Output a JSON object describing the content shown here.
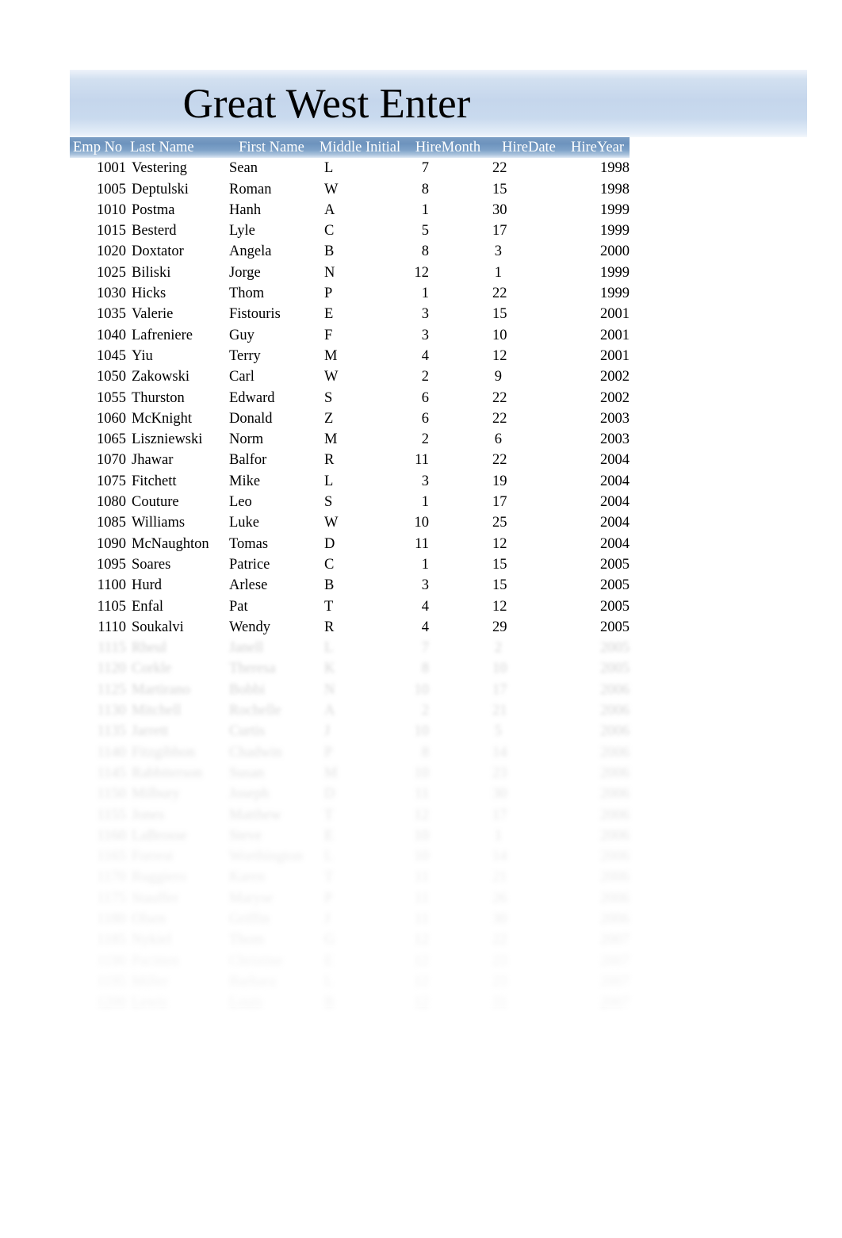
{
  "document": {
    "title": "Great West Enter",
    "accent_banner_color": "#c5d6ec",
    "header_row_color": "#6d93bd",
    "header_text_color": "#ffffff",
    "body_text_color": "#000000"
  },
  "table": {
    "columns": [
      {
        "key": "emp_no",
        "label": "Emp  No"
      },
      {
        "key": "last_name",
        "label": "Last Name"
      },
      {
        "key": "first_name",
        "label": "First Name"
      },
      {
        "key": "middle_initial",
        "label": "Middle Initial"
      },
      {
        "key": "hire_month",
        "label": "HireMonth"
      },
      {
        "key": "hire_date",
        "label": "HireDate"
      },
      {
        "key": "hire_year",
        "label": "HireYear"
      }
    ],
    "rows": [
      {
        "emp_no": "1001",
        "last_name": "Vestering",
        "first_name": "Sean",
        "middle_initial": "L",
        "hire_month": "7",
        "hire_date": "22",
        "hire_year": "1998",
        "legible": true
      },
      {
        "emp_no": "1005",
        "last_name": "Deptulski",
        "first_name": "Roman",
        "middle_initial": "W",
        "hire_month": "8",
        "hire_date": "15",
        "hire_year": "1998",
        "legible": true
      },
      {
        "emp_no": "1010",
        "last_name": "Postma",
        "first_name": "Hanh",
        "middle_initial": "A",
        "hire_month": "1",
        "hire_date": "30",
        "hire_year": "1999",
        "legible": true
      },
      {
        "emp_no": "1015",
        "last_name": "Besterd",
        "first_name": "Lyle",
        "middle_initial": "C",
        "hire_month": "5",
        "hire_date": "17",
        "hire_year": "1999",
        "legible": true
      },
      {
        "emp_no": "1020",
        "last_name": "Doxtator",
        "first_name": "Angela",
        "middle_initial": "B",
        "hire_month": "8",
        "hire_date": "3",
        "hire_year": "2000",
        "legible": true
      },
      {
        "emp_no": "1025",
        "last_name": "Biliski",
        "first_name": "Jorge",
        "middle_initial": "N",
        "hire_month": "12",
        "hire_date": "1",
        "hire_year": "1999",
        "legible": true
      },
      {
        "emp_no": "1030",
        "last_name": "Hicks",
        "first_name": "Thom",
        "middle_initial": "P",
        "hire_month": "1",
        "hire_date": "22",
        "hire_year": "1999",
        "legible": true
      },
      {
        "emp_no": "1035",
        "last_name": "Valerie",
        "first_name": "Fistouris",
        "middle_initial": "E",
        "hire_month": "3",
        "hire_date": "15",
        "hire_year": "2001",
        "legible": true
      },
      {
        "emp_no": "1040",
        "last_name": "Lafreniere",
        "first_name": "Guy",
        "middle_initial": "F",
        "hire_month": "3",
        "hire_date": "10",
        "hire_year": "2001",
        "legible": true
      },
      {
        "emp_no": "1045",
        "last_name": "Yiu",
        "first_name": "Terry",
        "middle_initial": "M",
        "hire_month": "4",
        "hire_date": "12",
        "hire_year": "2001",
        "legible": true
      },
      {
        "emp_no": "1050",
        "last_name": "Zakowski",
        "first_name": "Carl",
        "middle_initial": "W",
        "hire_month": "2",
        "hire_date": "9",
        "hire_year": "2002",
        "legible": true
      },
      {
        "emp_no": "1055",
        "last_name": "Thurston",
        "first_name": "Edward",
        "middle_initial": "S",
        "hire_month": "6",
        "hire_date": "22",
        "hire_year": "2002",
        "legible": true
      },
      {
        "emp_no": "1060",
        "last_name": "McKnight",
        "first_name": "Donald",
        "middle_initial": "Z",
        "hire_month": "6",
        "hire_date": "22",
        "hire_year": "2003",
        "legible": true
      },
      {
        "emp_no": "1065",
        "last_name": "Liszniewski",
        "first_name": "Norm",
        "middle_initial": "M",
        "hire_month": "2",
        "hire_date": "6",
        "hire_year": "2003",
        "legible": true
      },
      {
        "emp_no": "1070",
        "last_name": "Jhawar",
        "first_name": "Balfor",
        "middle_initial": "R",
        "hire_month": "11",
        "hire_date": "22",
        "hire_year": "2004",
        "legible": true
      },
      {
        "emp_no": "1075",
        "last_name": "Fitchett",
        "first_name": "Mike",
        "middle_initial": "L",
        "hire_month": "3",
        "hire_date": "19",
        "hire_year": "2004",
        "legible": true
      },
      {
        "emp_no": "1080",
        "last_name": "Couture",
        "first_name": "Leo",
        "middle_initial": "S",
        "hire_month": "1",
        "hire_date": "17",
        "hire_year": "2004",
        "legible": true
      },
      {
        "emp_no": "1085",
        "last_name": "Williams",
        "first_name": "Luke",
        "middle_initial": "W",
        "hire_month": "10",
        "hire_date": "25",
        "hire_year": "2004",
        "legible": true
      },
      {
        "emp_no": "1090",
        "last_name": "McNaughton",
        "first_name": "Tomas",
        "middle_initial": "D",
        "hire_month": "11",
        "hire_date": "12",
        "hire_year": "2004",
        "legible": true
      },
      {
        "emp_no": "1095",
        "last_name": "Soares",
        "first_name": "Patrice",
        "middle_initial": "C",
        "hire_month": "1",
        "hire_date": "15",
        "hire_year": "2005",
        "legible": true
      },
      {
        "emp_no": "1100",
        "last_name": "Hurd",
        "first_name": "Arlese",
        "middle_initial": "B",
        "hire_month": "3",
        "hire_date": "15",
        "hire_year": "2005",
        "legible": true
      },
      {
        "emp_no": "1105",
        "last_name": "Enfal",
        "first_name": "Pat",
        "middle_initial": "T",
        "hire_month": "4",
        "hire_date": "12",
        "hire_year": "2005",
        "legible": true
      },
      {
        "emp_no": "1110",
        "last_name": "Soukalvi",
        "first_name": "Wendy",
        "middle_initial": "R",
        "hire_month": "4",
        "hire_date": "29",
        "hire_year": "2005",
        "legible": true
      },
      {
        "emp_no": "1115",
        "last_name": "Rheul",
        "first_name": "Janell",
        "middle_initial": "L",
        "hire_month": "7",
        "hire_date": "2",
        "hire_year": "2005",
        "legible": false
      },
      {
        "emp_no": "1120",
        "last_name": "Corkle",
        "first_name": "Theresa",
        "middle_initial": "K",
        "hire_month": "8",
        "hire_date": "10",
        "hire_year": "2005",
        "legible": false
      },
      {
        "emp_no": "1125",
        "last_name": "Martirano",
        "first_name": "Bobbi",
        "middle_initial": "N",
        "hire_month": "10",
        "hire_date": "17",
        "hire_year": "2006",
        "legible": false
      },
      {
        "emp_no": "1130",
        "last_name": "Mitchell",
        "first_name": "Rochelle",
        "middle_initial": "A",
        "hire_month": "2",
        "hire_date": "21",
        "hire_year": "2006",
        "legible": false
      },
      {
        "emp_no": "1135",
        "last_name": "Jarrett",
        "first_name": "Curtis",
        "middle_initial": "J",
        "hire_month": "10",
        "hire_date": "5",
        "hire_year": "2006",
        "legible": false
      },
      {
        "emp_no": "1140",
        "last_name": "Fitzgibbon",
        "first_name": "Chadwin",
        "middle_initial": "P",
        "hire_month": "8",
        "hire_date": "14",
        "hire_year": "2006",
        "legible": false
      },
      {
        "emp_no": "1145",
        "last_name": "Rabbiterson",
        "first_name": "Susan",
        "middle_initial": "M",
        "hire_month": "10",
        "hire_date": "23",
        "hire_year": "2006",
        "legible": false
      },
      {
        "emp_no": "1150",
        "last_name": "Milbury",
        "first_name": "Joseph",
        "middle_initial": "D",
        "hire_month": "11",
        "hire_date": "30",
        "hire_year": "2006",
        "legible": false
      },
      {
        "emp_no": "1155",
        "last_name": "Jones",
        "first_name": "Matthew",
        "middle_initial": "T",
        "hire_month": "12",
        "hire_date": "17",
        "hire_year": "2006",
        "legible": false
      },
      {
        "emp_no": "1160",
        "last_name": "LaBrosse",
        "first_name": "Steve",
        "middle_initial": "E",
        "hire_month": "10",
        "hire_date": "1",
        "hire_year": "2006",
        "legible": false
      },
      {
        "emp_no": "1165",
        "last_name": "Forrest",
        "first_name": "Worthington",
        "middle_initial": "L",
        "hire_month": "10",
        "hire_date": "14",
        "hire_year": "2006",
        "legible": false
      },
      {
        "emp_no": "1170",
        "last_name": "Ruggiero",
        "first_name": "Karen",
        "middle_initial": "T",
        "hire_month": "11",
        "hire_date": "21",
        "hire_year": "2006",
        "legible": false
      },
      {
        "emp_no": "1175",
        "last_name": "Stauffer",
        "first_name": "Maryse",
        "middle_initial": "P",
        "hire_month": "11",
        "hire_date": "26",
        "hire_year": "2006",
        "legible": false
      },
      {
        "emp_no": "1180",
        "last_name": "Olsen",
        "first_name": "Griffin",
        "middle_initial": "J",
        "hire_month": "11",
        "hire_date": "30",
        "hire_year": "2006",
        "legible": false
      },
      {
        "emp_no": "1185",
        "last_name": "Nykiel",
        "first_name": "Thom",
        "middle_initial": "G",
        "hire_month": "12",
        "hire_date": "22",
        "hire_year": "2007",
        "legible": false
      },
      {
        "emp_no": "1190",
        "last_name": "Pacitten",
        "first_name": "Christine",
        "middle_initial": "E",
        "hire_month": "12",
        "hire_date": "23",
        "hire_year": "2007",
        "legible": false
      },
      {
        "emp_no": "1195",
        "last_name": "Miller",
        "first_name": "Barbara",
        "middle_initial": "L",
        "hire_month": "12",
        "hire_date": "23",
        "hire_year": "2007",
        "legible": false
      },
      {
        "emp_no": "1200",
        "last_name": "Lewis",
        "first_name": "Louis",
        "middle_initial": "B",
        "hire_month": "12",
        "hire_date": "31",
        "hire_year": "2007",
        "legible": false
      }
    ]
  }
}
